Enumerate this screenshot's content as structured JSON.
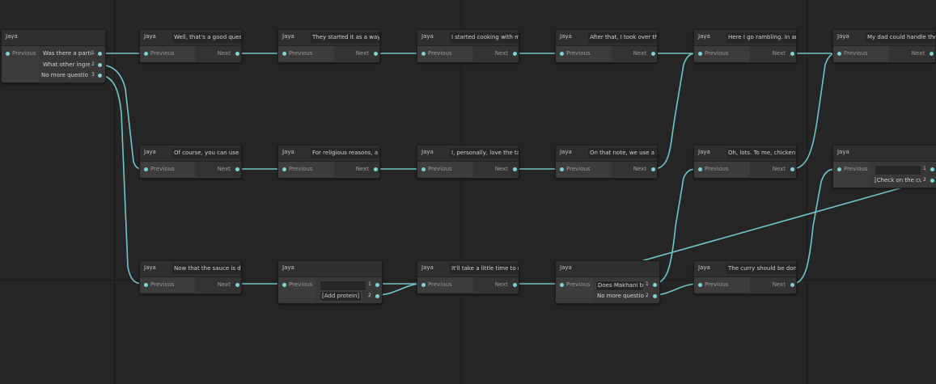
{
  "colors": {
    "background": "#252525",
    "wire": "#6fc6c9",
    "port": "#7fd3d6"
  },
  "ports": {
    "previous": "Previous",
    "next": "Next"
  },
  "start": {
    "speaker": "Jaya",
    "choices": [
      {
        "num": "1",
        "text": "Was there a parti"
      },
      {
        "num": "2",
        "text": "What other ingrec"
      },
      {
        "num": "3",
        "text": "No more questior"
      }
    ]
  },
  "nodes": {
    "r1c2": {
      "speaker": "Jaya",
      "text": "Well, that's a good questic"
    },
    "r1c3": {
      "speaker": "Jaya",
      "text": "They started it as a way t"
    },
    "r1c4": {
      "speaker": "Jaya",
      "text": "I started cooking with my"
    },
    "r1c5": {
      "speaker": "Jaya",
      "text": "After that, I took over the r"
    },
    "r1c6": {
      "speaker": "Jaya",
      "text": "Here I go rambling. In any"
    },
    "r1c7": {
      "speaker": "Jaya",
      "text": "My dad could handle the"
    },
    "r2c2": {
      "speaker": "Jaya",
      "text": "Of course, you can use wl"
    },
    "r2c3": {
      "speaker": "Jaya",
      "text": "For religious reasons, a lo"
    },
    "r2c4": {
      "speaker": "Jaya",
      "text": "I, personally, love the tast"
    },
    "r2c5": {
      "speaker": "Jaya",
      "text": "On that note, we use a lot"
    },
    "r2c6": {
      "speaker": "Jaya",
      "text": "Oh, lots. To me, chicken i"
    },
    "r3c2": {
      "speaker": "Jaya",
      "text": "Now that the sauce is don"
    },
    "r3c4": {
      "speaker": "Jaya",
      "text": "It'll take a little time to ma"
    },
    "r3c6": {
      "speaker": "Jaya",
      "text": "The curry should be done"
    }
  },
  "choice_nodes": {
    "r3c3": {
      "speaker": "Jaya",
      "choices": [
        {
          "num": "1",
          "text": ""
        },
        {
          "num": "2",
          "text": "[Add protein]"
        }
      ]
    },
    "r3c5": {
      "speaker": "Jaya",
      "choices": [
        {
          "num": "1",
          "text": "Does Makhani br"
        },
        {
          "num": "2",
          "text": "No more questior"
        }
      ]
    },
    "r2c7": {
      "speaker": "Jaya",
      "choices": [
        {
          "num": "1",
          "text": ""
        },
        {
          "num": "2",
          "text": "[Check on the cu"
        }
      ]
    }
  }
}
